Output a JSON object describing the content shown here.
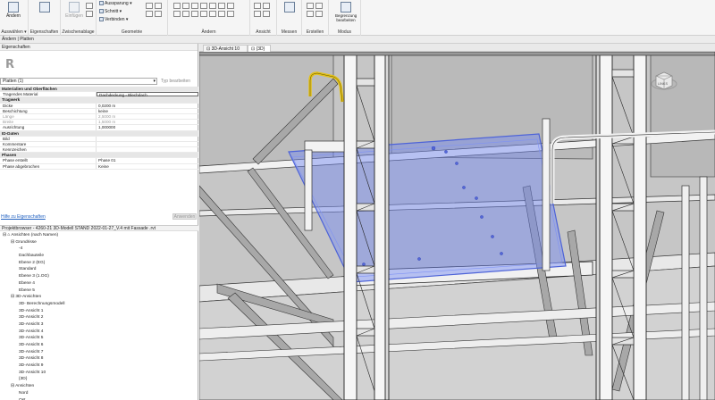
{
  "ribbon": {
    "modify_label": "Ändern",
    "select_label": "Auswählen ▾",
    "properties_label": "Eigenschaften",
    "clipboard_label": "Zwischenablage",
    "paste_label": "Einfügen",
    "geometry_label": "Geometrie",
    "cutout_label": "Aussparung ▾",
    "cut_label": "Schnitt ▾",
    "join_label": "Verbinden ▾",
    "modify_group_label": "Ändern",
    "view_label": "Ansicht",
    "measure_label": "Messen",
    "create_label": "Erstellen",
    "boundary_label": "Begrenzung bearbeiten",
    "mode_label": "Modus"
  },
  "context_bar": "Ändern | Platten",
  "properties": {
    "title": "Eigenschaften",
    "type_selector": "Platten (1)",
    "edit_type": "Typ bearbeiten",
    "rows": [
      {
        "cat": true,
        "k": "Materialien und Oberflächen"
      },
      {
        "k": "Tragendes Material",
        "v": "Dachdeckung - Blechdach",
        "sel": true
      },
      {
        "cat": true,
        "k": "Tragwerk"
      },
      {
        "k": "Dicke",
        "v": "0,0200 m"
      },
      {
        "k": "Beschichtung",
        "v": "keine"
      },
      {
        "k": "Länge",
        "v": "2,5000 m",
        "dim": true
      },
      {
        "k": "Breite",
        "v": "1,5000 m",
        "dim": true
      },
      {
        "k": "Ausrichtung",
        "v": "1,000000"
      },
      {
        "cat": true,
        "k": "ID-Daten"
      },
      {
        "k": "Bild",
        "v": ""
      },
      {
        "k": "Kommentare",
        "v": ""
      },
      {
        "k": "Kennzeichen",
        "v": ""
      },
      {
        "cat": true,
        "k": "Phasen"
      },
      {
        "k": "Phase erstellt",
        "v": "Phase 01"
      },
      {
        "k": "Phase abgebrochen",
        "v": "Keine"
      }
    ],
    "help_link": "Hilfe zu Eigenschaften",
    "apply": "Anwenden"
  },
  "browser": {
    "title": "Projektbrowser - 4260-21 3D-Modell STAND 2022-01-27_V.4 mit Fassade .rvt",
    "items": [
      {
        "d": 0,
        "t": "⊟  ⌂  Ansichten (nach Namen)"
      },
      {
        "d": 1,
        "t": "⊟  Grundrisse"
      },
      {
        "d": 2,
        "t": "-4"
      },
      {
        "d": 2,
        "t": "Dachbauteile"
      },
      {
        "d": 2,
        "t": "Ebene 2 (EG)"
      },
      {
        "d": 2,
        "t": "Standard"
      },
      {
        "d": 2,
        "t": "Ebene 3 (1.OG)"
      },
      {
        "d": 2,
        "t": "Ebene 4"
      },
      {
        "d": 2,
        "t": "Ebene 5"
      },
      {
        "d": 1,
        "t": "⊟  3D-Ansichten"
      },
      {
        "d": 2,
        "t": "3D- Berechnungsmodell"
      },
      {
        "d": 2,
        "t": "3D-Ansicht 1"
      },
      {
        "d": 2,
        "t": "3D-Ansicht 2"
      },
      {
        "d": 2,
        "t": "3D-Ansicht 3"
      },
      {
        "d": 2,
        "t": "3D-Ansicht 4"
      },
      {
        "d": 2,
        "t": "3D-Ansicht 5"
      },
      {
        "d": 2,
        "t": "3D-Ansicht 6"
      },
      {
        "d": 2,
        "t": "3D-Ansicht 7"
      },
      {
        "d": 2,
        "t": "3D-Ansicht 8"
      },
      {
        "d": 2,
        "t": "3D-Ansicht 9"
      },
      {
        "d": 2,
        "t": "3D-Ansicht 10"
      },
      {
        "d": 2,
        "t": "{3D}"
      },
      {
        "d": 1,
        "t": "⊟  Ansichten"
      },
      {
        "d": 2,
        "t": "Nord"
      },
      {
        "d": 2,
        "t": "Ost"
      }
    ]
  },
  "tabs": [
    {
      "label": "3D-Ansicht 10"
    },
    {
      "label": "{3D}"
    }
  ],
  "viewcube_label": "LINKS",
  "colors": {
    "selection_blue": "#6e86f2",
    "handrail_yellow": "#e3c21b",
    "viewport_bg": "#c9c9c9"
  }
}
